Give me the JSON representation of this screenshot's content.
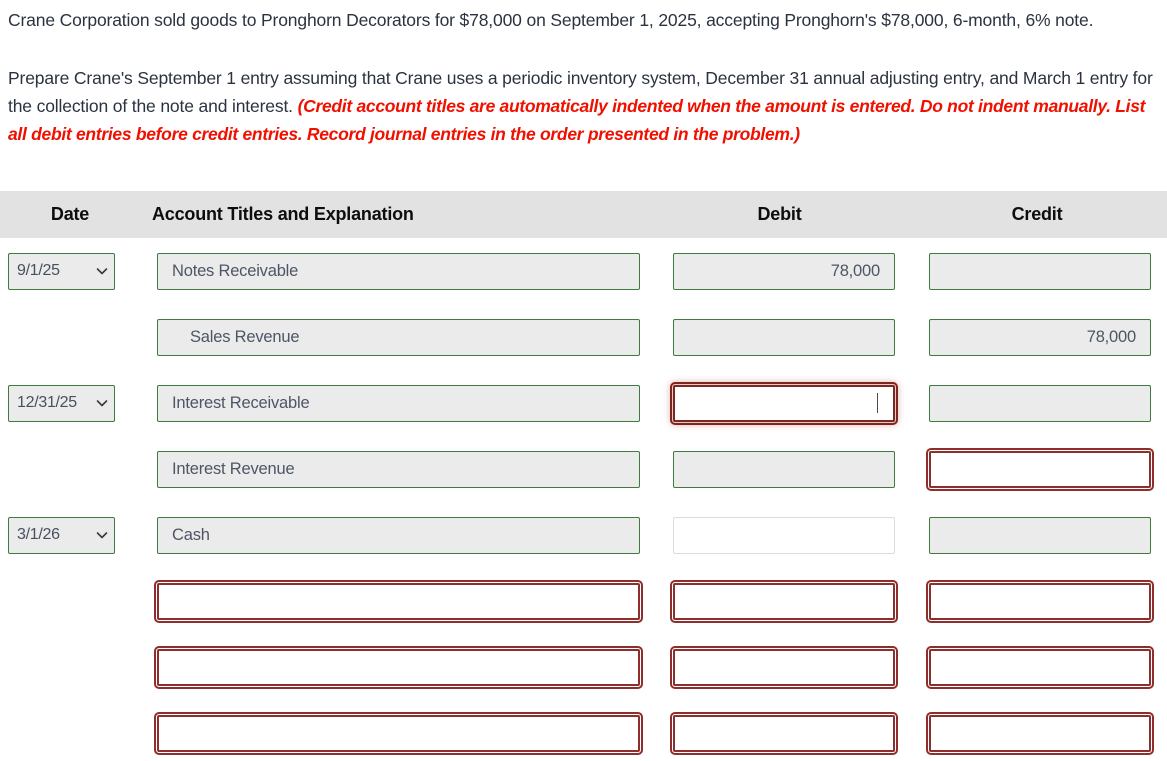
{
  "problem": {
    "paragraph_1": "Crane Corporation sold goods to Pronghorn Decorators for $78,000 on September 1, 2025, accepting Pronghorn's $78,000, 6-month, 6% note.",
    "paragraph_2_part_1": "Prepare Crane's September 1 entry assuming that Crane uses a periodic inventory system, December 31 annual adjusting entry, and March 1 entry for the collection of the note and interest. ",
    "paragraph_2_instruction": "(Credit account titles are automatically indented when the amount is entered. Do not indent manually. List all debit entries before credit entries. Record journal entries in the order presented in the problem.)"
  },
  "table": {
    "headers": {
      "date": "Date",
      "account": "Account Titles and Explanation",
      "debit": "Debit",
      "credit": "Credit"
    },
    "rows": [
      {
        "date": "9/1/25",
        "has_date": true,
        "account": "Notes Receivable",
        "account_indented": false,
        "account_state": "state-filled",
        "debit": "78,000",
        "debit_state": "state-filled",
        "credit": "",
        "credit_state": "state-blank-green"
      },
      {
        "date": "",
        "has_date": false,
        "account": "Sales Revenue",
        "account_indented": true,
        "account_state": "state-filled",
        "debit": "",
        "debit_state": "state-blank-green",
        "credit": "78,000",
        "credit_state": "state-filled"
      },
      {
        "date": "12/31/25",
        "has_date": true,
        "account": "Interest Receivable",
        "account_indented": false,
        "account_state": "state-filled",
        "debit": "",
        "debit_state": "state-error-focus",
        "debit_focused": true,
        "credit": "",
        "credit_state": "state-blank-green"
      },
      {
        "date": "",
        "has_date": false,
        "account": "Interest Revenue",
        "account_indented": false,
        "account_state": "state-filled",
        "debit": "",
        "debit_state": "state-blank-green",
        "credit": "",
        "credit_state": "state-error"
      },
      {
        "date": "3/1/26",
        "has_date": true,
        "account": "Cash",
        "account_indented": false,
        "account_state": "state-filled",
        "debit": "",
        "debit_state": "state-neutral",
        "credit": "",
        "credit_state": "state-blank-green"
      },
      {
        "date": "",
        "has_date": false,
        "account": "",
        "account_indented": false,
        "account_state": "state-error",
        "debit": "",
        "debit_state": "state-error",
        "credit": "",
        "credit_state": "state-error"
      },
      {
        "date": "",
        "has_date": false,
        "account": "",
        "account_indented": false,
        "account_state": "state-error",
        "debit": "",
        "debit_state": "state-error",
        "credit": "",
        "credit_state": "state-error"
      },
      {
        "date": "",
        "has_date": false,
        "account": "",
        "account_indented": false,
        "account_state": "state-error",
        "debit": "",
        "debit_state": "state-error",
        "credit": "",
        "credit_state": "state-error"
      }
    ]
  },
  "icons": {
    "chevron_down": "chevron-down-icon"
  },
  "colors": {
    "instruction_red": "#f01000",
    "field_border_green": "#3f7a3f",
    "field_border_error": "#8d2f2c",
    "field_fill_gray": "#ebebeb",
    "header_bg": "#e2e2e2",
    "body_text": "#2b3340"
  }
}
